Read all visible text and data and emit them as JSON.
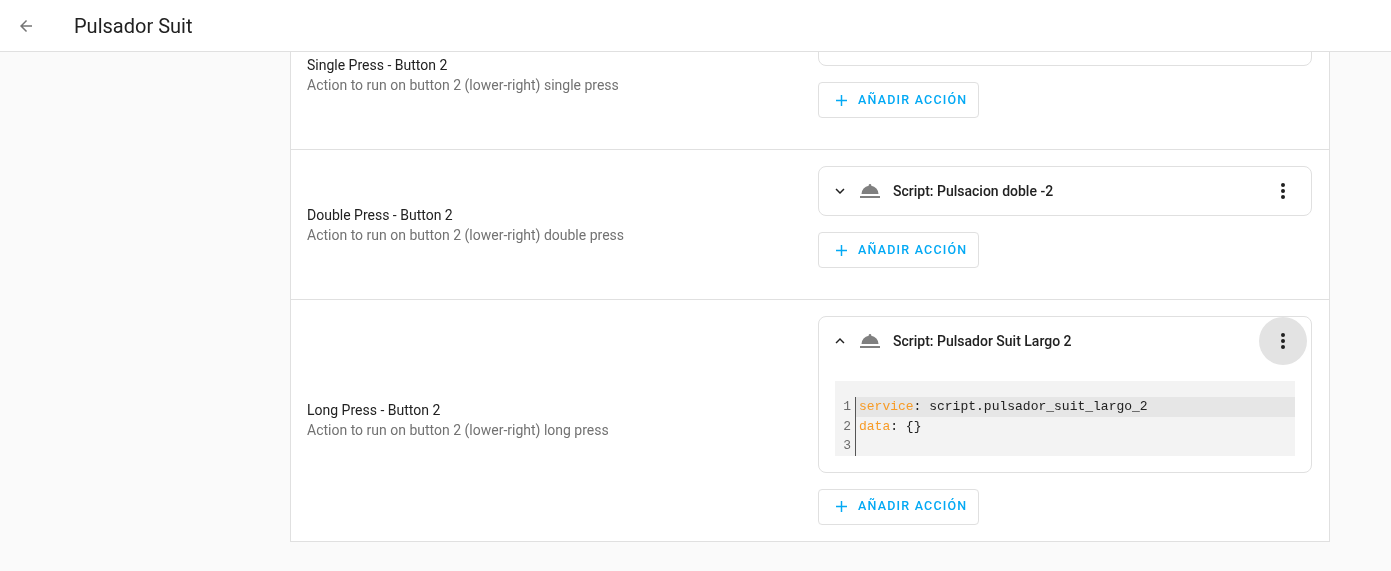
{
  "header": {
    "title": "Pulsador Suit"
  },
  "sections": [
    {
      "title": "Single Press - Button 2",
      "description": "Action to run on button 2 (lower-right) single press",
      "actions": [
        {
          "kind": "clipped"
        }
      ],
      "add_button": "AÑADIR ACCIÓN"
    },
    {
      "title": "Double Press - Button 2",
      "description": "Action to run on button 2 (lower-right) double press",
      "actions": [
        {
          "title": "Script: Pulsacion doble -2",
          "expanded": false,
          "menu_focused": false
        }
      ],
      "add_button": "AÑADIR ACCIÓN"
    },
    {
      "title": "Long Press - Button 2",
      "description": "Action to run on button 2 (lower-right) long press",
      "actions": [
        {
          "title": "Script: Pulsador Suit Largo 2",
          "expanded": true,
          "menu_focused": true,
          "code": [
            {
              "number": "1",
              "key": "service",
              "separator": ":",
              "value": "script.pulsador_suit_largo_2",
              "active": true
            },
            {
              "number": "2",
              "key": "data",
              "separator": ":",
              "value": "{}",
              "active": false
            },
            {
              "number": "3",
              "active": false
            }
          ]
        }
      ],
      "add_button": "AÑADIR ACCIÓN"
    }
  ]
}
